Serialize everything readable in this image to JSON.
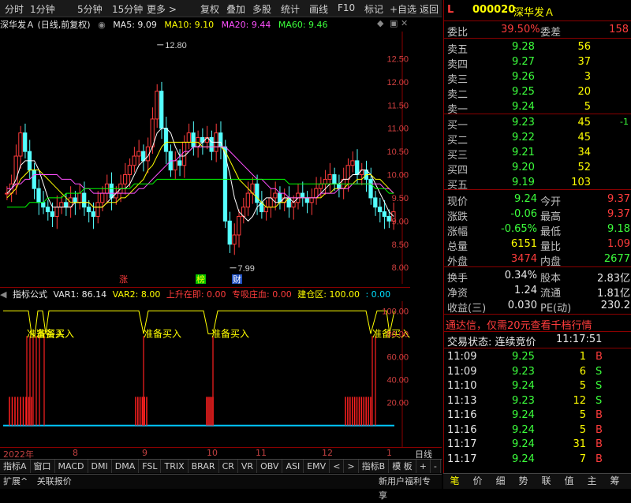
{
  "topbar": {
    "items": [
      "分时",
      "1分钟",
      "5分钟",
      "15分钟",
      "更多 >",
      "复权",
      "叠加",
      "多股",
      "统计",
      "画线",
      "F10",
      "标记",
      "+自选",
      "返回"
    ]
  },
  "chart_info": {
    "title": "深华发Ａ (日线,前复权)",
    "ma5": "MA5: 9.09",
    "ma10": "MA10: 9.10",
    "ma20": "MA20: 9.44",
    "ma60": "MA60: 9.46",
    "colors": {
      "ma5": "#ffffff",
      "ma10": "#ffff00",
      "ma20": "#ff50ff",
      "ma60": "#00ff00"
    }
  },
  "chart_data": [
    {
      "type": "candlestick",
      "yticks": [
        "12.50",
        "12.00",
        "11.50",
        "11.00",
        "10.50",
        "10.00",
        "9.50",
        "9.00",
        "8.50",
        "8.00"
      ],
      "ylim": [
        7.85,
        12.95
      ],
      "high_label": "12.80",
      "low_label": "7.99",
      "markers": [
        "涨",
        "榜",
        "财"
      ],
      "series": [
        {
          "name": "MA5"
        },
        {
          "name": "MA10"
        },
        {
          "name": "MA20"
        },
        {
          "name": "MA60"
        }
      ],
      "close": [
        9.6,
        9.8,
        10.4,
        10.9,
        10.5,
        10.1,
        9.7,
        9.4,
        9.3,
        9.2,
        9.1,
        9.3,
        9.4,
        9.3,
        9.5,
        9.4,
        9.6,
        9.3,
        9.2,
        9.1,
        9.4,
        9.6,
        9.8,
        9.5,
        9.6,
        9.8,
        10.0,
        10.2,
        10.4,
        10.5,
        10.3,
        10.6,
        11.2,
        11.8,
        11.0,
        10.5,
        10.1,
        10.3,
        10.2,
        10.7,
        10.9,
        10.6,
        10.8,
        10.7,
        10.8,
        10.5,
        10.9,
        10.6,
        9.0,
        8.5,
        8.7,
        9.1,
        9.3,
        9.6,
        9.8,
        9.4,
        9.2,
        9.3,
        9.5,
        9.6,
        9.4,
        9.5,
        9.3,
        9.4,
        9.6,
        9.5,
        9.4,
        9.5,
        9.7,
        9.8,
        9.9,
        10.0,
        9.8,
        9.7,
        9.9,
        10.2,
        10.3,
        10.0,
        10.1,
        9.9,
        9.5,
        9.3,
        9.2,
        9.1,
        9.0,
        9.2
      ],
      "volume_note": "",
      "ma5": [
        9.6,
        9.7,
        9.9,
        10.2,
        10.3,
        10.3,
        10.3,
        10.1,
        9.8,
        9.5,
        9.3,
        9.3,
        9.3,
        9.3,
        9.3,
        9.4,
        9.4,
        9.4,
        9.4,
        9.3,
        9.3,
        9.3,
        9.4,
        9.5,
        9.6,
        9.7,
        9.7,
        9.8,
        10.0,
        10.2,
        10.3,
        10.4,
        10.6,
        10.9,
        11.0,
        11.0,
        10.9,
        10.6,
        10.4,
        10.4,
        10.5,
        10.6,
        10.6,
        10.7,
        10.8,
        10.7,
        10.7,
        10.7,
        10.4,
        10.0,
        9.5,
        9.2,
        9.1,
        9.0,
        9.1,
        9.3,
        9.4,
        9.5,
        9.5,
        9.4,
        9.4,
        9.5,
        9.5,
        9.4,
        9.5,
        9.5,
        9.5,
        9.5,
        9.5,
        9.6,
        9.7,
        9.8,
        9.8,
        9.8,
        9.9,
        9.9,
        10.0,
        10.0,
        10.1,
        10.1,
        10.0,
        9.8,
        9.6,
        9.4,
        9.2,
        9.1
      ],
      "ma10": [
        9.5,
        9.6,
        9.7,
        9.9,
        10.0,
        10.1,
        10.1,
        10.1,
        10.0,
        9.9,
        9.8,
        9.7,
        9.6,
        9.5,
        9.4,
        9.4,
        9.4,
        9.4,
        9.4,
        9.3,
        9.3,
        9.3,
        9.4,
        9.4,
        9.4,
        9.5,
        9.5,
        9.6,
        9.7,
        9.8,
        9.9,
        10.1,
        10.2,
        10.4,
        10.6,
        10.7,
        10.7,
        10.7,
        10.7,
        10.7,
        10.7,
        10.7,
        10.7,
        10.6,
        10.6,
        10.6,
        10.6,
        10.6,
        10.5,
        10.3,
        10.1,
        9.9,
        9.8,
        9.7,
        9.6,
        9.5,
        9.4,
        9.3,
        9.3,
        9.3,
        9.4,
        9.4,
        9.5,
        9.5,
        9.5,
        9.5,
        9.5,
        9.5,
        9.5,
        9.5,
        9.6,
        9.6,
        9.7,
        9.7,
        9.7,
        9.8,
        9.8,
        9.9,
        9.9,
        10.0,
        10.0,
        9.9,
        9.9,
        9.8,
        9.7,
        9.6
      ],
      "ma20": [
        9.7,
        9.7,
        9.8,
        9.8,
        9.9,
        9.9,
        10.0,
        10.0,
        10.0,
        10.0,
        10.0,
        10.0,
        9.9,
        9.9,
        9.9,
        9.8,
        9.8,
        9.7,
        9.7,
        9.6,
        9.6,
        9.6,
        9.6,
        9.6,
        9.6,
        9.6,
        9.6,
        9.6,
        9.6,
        9.7,
        9.7,
        9.8,
        9.9,
        10.0,
        10.1,
        10.2,
        10.3,
        10.3,
        10.4,
        10.5,
        10.5,
        10.6,
        10.6,
        10.6,
        10.6,
        10.6,
        10.6,
        10.6,
        10.6,
        10.5,
        10.4,
        10.3,
        10.2,
        10.1,
        10.0,
        9.9,
        9.9,
        9.8,
        9.7,
        9.7,
        9.6,
        9.6,
        9.5,
        9.5,
        9.5,
        9.5,
        9.5,
        9.5,
        9.5,
        9.6,
        9.6,
        9.6,
        9.6,
        9.7,
        9.7,
        9.7,
        9.8,
        9.8,
        9.8,
        9.8,
        9.8,
        9.8,
        9.8,
        9.7,
        9.7,
        9.6
      ],
      "ma60": [
        9.3,
        9.3,
        9.3,
        9.3,
        9.3,
        9.4,
        9.4,
        9.4,
        9.4,
        9.5,
        9.5,
        9.5,
        9.5,
        9.6,
        9.6,
        9.6,
        9.6,
        9.7,
        9.7,
        9.7,
        9.7,
        9.7,
        9.7,
        9.7,
        9.7,
        9.7,
        9.7,
        9.7,
        9.8,
        9.8,
        9.8,
        9.8,
        9.8,
        9.9,
        9.9,
        9.9,
        9.9,
        9.9,
        9.9,
        9.9,
        9.9,
        9.9,
        9.9,
        9.9,
        9.9,
        9.9,
        9.9,
        9.9,
        9.9,
        9.9,
        9.9,
        9.9,
        9.9,
        9.9,
        9.9,
        9.9,
        9.9,
        9.9,
        9.9,
        9.9,
        9.9,
        9.9,
        9.8,
        9.8,
        9.8,
        9.8,
        9.8,
        9.8,
        9.8,
        9.8,
        9.8,
        9.8,
        9.8,
        9.8,
        9.8,
        9.8,
        9.8,
        9.8,
        9.8,
        9.8,
        9.8,
        9.7,
        9.7,
        9.7,
        9.6,
        9.6
      ]
    },
    {
      "type": "line",
      "yticks": [
        "100.00",
        "80.00",
        "60.00",
        "40.00",
        "20.00"
      ],
      "ylim": [
        -5,
        105
      ],
      "signal_label": "准备买入"
    }
  ],
  "indicator_info": {
    "name": "指标公式",
    "var1": "VAR1: 86.14",
    "var2": "VAR2: 8.00",
    "up": "上升在即: 0.00",
    "absorb": "专吸庄血: 0.00",
    "build": "建仓区: 100.00",
    "extra": ": 0.00"
  },
  "date_axis": [
    "2022年",
    "8",
    "9",
    "10",
    "11",
    "12",
    "1"
  ],
  "date_right": "日线",
  "bottom_tabs": [
    "指标A",
    "窗口",
    "MACD",
    "DMI",
    "DMA",
    "FSL",
    "TRIX",
    "BRAR",
    "CR",
    "VR",
    "OBV",
    "ASI",
    "EMV",
    "<",
    ">",
    "指标B",
    "模 板",
    "+",
    "-"
  ],
  "status_bar": [
    "扩展^",
    "关联报价",
    "新用户福利专享"
  ],
  "right_panel": {
    "code": "000020",
    "name": "深华发Ａ",
    "weibi_label": "委比",
    "weibi": "39.50%",
    "weicha_label": "委差",
    "weicha": "158",
    "asks": [
      {
        "label": "卖五",
        "price": "9.28",
        "vol": "56"
      },
      {
        "label": "卖四",
        "price": "9.27",
        "vol": "37"
      },
      {
        "label": "卖三",
        "price": "9.26",
        "vol": "3"
      },
      {
        "label": "卖二",
        "price": "9.25",
        "vol": "20"
      },
      {
        "label": "卖一",
        "price": "9.24",
        "vol": "5"
      }
    ],
    "bids": [
      {
        "label": "买一",
        "price": "9.23",
        "vol": "45",
        "chg": "-1"
      },
      {
        "label": "买二",
        "price": "9.22",
        "vol": "45",
        "chg": ""
      },
      {
        "label": "买三",
        "price": "9.21",
        "vol": "34",
        "chg": ""
      },
      {
        "label": "买四",
        "price": "9.20",
        "vol": "52",
        "chg": ""
      },
      {
        "label": "买五",
        "price": "9.19",
        "vol": "103",
        "chg": ""
      }
    ],
    "stats": [
      {
        "l1": "现价",
        "v1": "9.24",
        "l2": "今开",
        "v2": "9.37"
      },
      {
        "l1": "涨跌",
        "v1": "-0.06",
        "l2": "最高",
        "v2": "9.37"
      },
      {
        "l1": "涨幅",
        "v1": "-0.65%",
        "l2": "最低",
        "v2": "9.18"
      },
      {
        "l1": "总量",
        "v1": "6151",
        "l2": "量比",
        "v2": "1.09"
      },
      {
        "l1": "外盘",
        "v1": "3474",
        "l2": "内盘",
        "v2": "2677"
      }
    ],
    "stats2": [
      {
        "l1": "换手",
        "v1": "0.34%",
        "l2": "股本",
        "v2": "2.83亿"
      },
      {
        "l1": "净资",
        "v1": "1.24",
        "l2": "流通",
        "v2": "1.81亿"
      },
      {
        "l1": "收益(三)",
        "v1": "0.030",
        "l2": "PE(动)",
        "v2": "230.2"
      }
    ],
    "ad": "通达信，仅需20元查看千档行情",
    "trade_state_label": "交易状态: 连续竞价",
    "trade_time": "11:17:51",
    "ticks": [
      {
        "t": "11:09",
        "p": "9.25",
        "v": "1",
        "d": "B"
      },
      {
        "t": "11:09",
        "p": "9.23",
        "v": "6",
        "d": "S"
      },
      {
        "t": "11:10",
        "p": "9.24",
        "v": "5",
        "d": "S"
      },
      {
        "t": "11:13",
        "p": "9.23",
        "v": "12",
        "d": "S"
      },
      {
        "t": "11:16",
        "p": "9.24",
        "v": "5",
        "d": "B"
      },
      {
        "t": "11:16",
        "p": "9.24",
        "v": "5",
        "d": "B"
      },
      {
        "t": "11:17",
        "p": "9.24",
        "v": "31",
        "d": "B"
      },
      {
        "t": "11:17",
        "p": "9.24",
        "v": "7",
        "d": "B"
      }
    ],
    "tabs": [
      "笔",
      "价",
      "细",
      "势",
      "联",
      "值",
      "主",
      "筹"
    ]
  }
}
